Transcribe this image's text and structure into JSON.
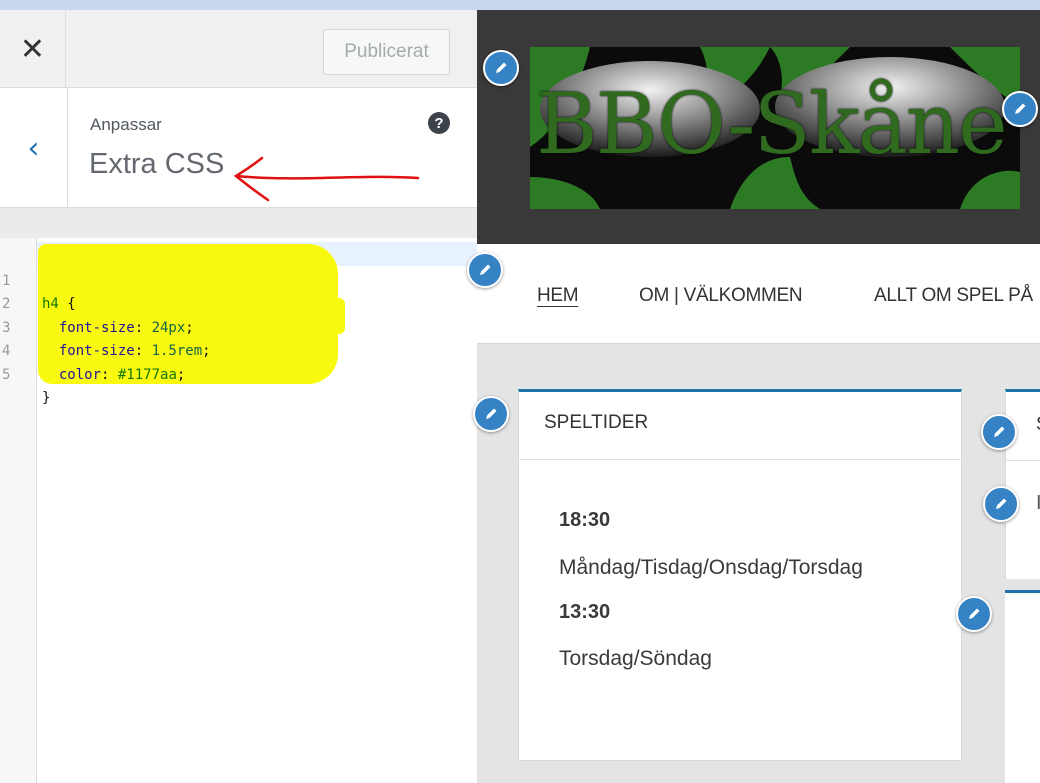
{
  "header": {
    "publish_label": "Publicerat"
  },
  "section": {
    "breadcrumb": "Anpassar",
    "title": "Extra CSS"
  },
  "editor": {
    "lines": [
      {
        "n": "1",
        "text": "h4 {"
      },
      {
        "n": "2",
        "text": "font-size: 24px;"
      },
      {
        "n": "3",
        "text": "font-size: 1.5rem;"
      },
      {
        "n": "4",
        "text": "color: #1177aa;"
      },
      {
        "n": "5",
        "text": "}"
      }
    ]
  },
  "preview": {
    "logo_text": "BBO-Skåne",
    "nav": [
      "HEM",
      "OM | VÄLKOMMEN",
      "ALLT OM SPEL PÅ"
    ],
    "widget": {
      "title": "SPELTIDER",
      "time1": "18:30",
      "days1": "Måndag/Tisdag/Onsdag/Torsdag",
      "time2": "13:30",
      "days2": "Torsdag/Söndag"
    },
    "widget2_title": "S",
    "widget2_text": "I"
  },
  "colors": {
    "accent": "#2271b1",
    "widget_border": "#1c73a8",
    "highlight": "#f9f90f",
    "annotation_arrow": "#e01010"
  }
}
